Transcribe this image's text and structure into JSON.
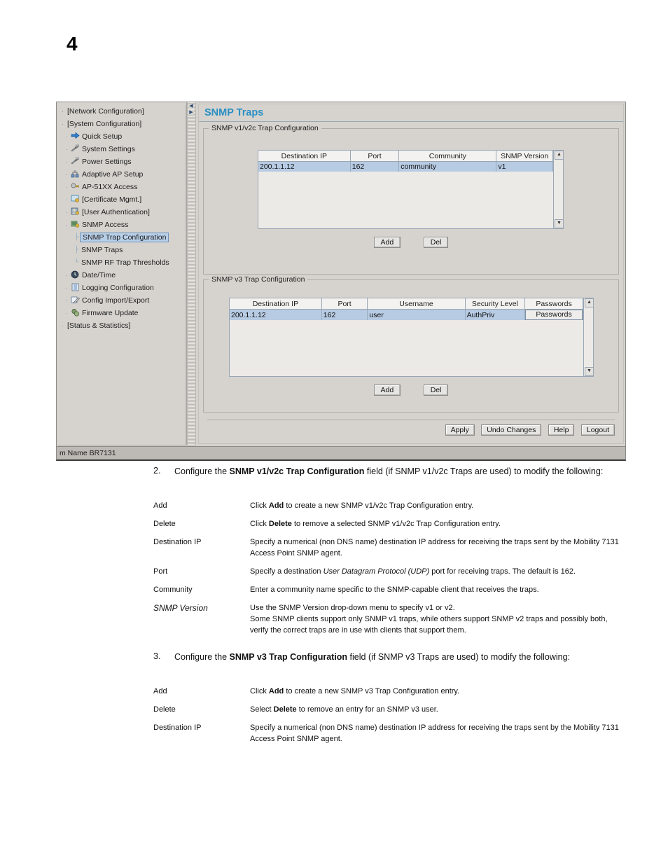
{
  "page": {
    "number": "4"
  },
  "screenshot": {
    "panel_title": "SNMP Traps",
    "sidebar": {
      "items": [
        {
          "label": "[Network Configuration]",
          "icon": "none",
          "level": 0,
          "selected": false
        },
        {
          "label": "[System Configuration]",
          "icon": "none",
          "level": 0,
          "selected": false
        },
        {
          "label": "Quick Setup",
          "icon": "arrow-right-icon",
          "level": 1,
          "selected": false
        },
        {
          "label": "System Settings",
          "icon": "wrench-icon",
          "level": 1,
          "selected": false
        },
        {
          "label": "Power Settings",
          "icon": "wrench-icon",
          "level": 1,
          "selected": false
        },
        {
          "label": "Adaptive AP Setup",
          "icon": "network-icon",
          "level": 1,
          "selected": false
        },
        {
          "label": "AP-51XX Access",
          "icon": "key-icon",
          "level": 1,
          "selected": false
        },
        {
          "label": "[Certificate Mgmt.]",
          "icon": "certificate-icon",
          "level": 1,
          "selected": false
        },
        {
          "label": "[User Authentication]",
          "icon": "user-key-icon",
          "level": 1,
          "selected": false
        },
        {
          "label": "SNMP Access",
          "icon": "snmp-key-icon",
          "level": 1,
          "selected": false
        },
        {
          "label": "SNMP Trap Configuration",
          "icon": "none",
          "level": 2,
          "selected": true
        },
        {
          "label": "SNMP Traps",
          "icon": "none",
          "level": 2,
          "selected": false
        },
        {
          "label": "SNMP RF Trap Thresholds",
          "icon": "none",
          "level": 2,
          "selected": false
        },
        {
          "label": "Date/Time",
          "icon": "clock-icon",
          "level": 1,
          "selected": false
        },
        {
          "label": "Logging Configuration",
          "icon": "list-icon",
          "level": 1,
          "selected": false
        },
        {
          "label": "Config Import/Export",
          "icon": "pencil-icon",
          "level": 1,
          "selected": false
        },
        {
          "label": "Firmware Update",
          "icon": "chips-icon",
          "level": 1,
          "selected": false
        },
        {
          "label": "[Status & Statistics]",
          "icon": "none",
          "level": 0,
          "selected": false
        }
      ]
    },
    "group_v1": {
      "legend": "SNMP v1/v2c Trap Configuration",
      "columns": [
        "Destination IP",
        "Port",
        "Community",
        "SNMP Version"
      ],
      "rows": [
        [
          "200.1.1.12",
          "162",
          "community",
          "v1"
        ]
      ],
      "add_label": "Add",
      "del_label": "Del"
    },
    "group_v3": {
      "legend": "SNMP v3 Trap Configuration",
      "columns": [
        "Destination IP",
        "Port",
        "Username",
        "Security Level",
        "Passwords"
      ],
      "rows": [
        [
          "200.1.1.12",
          "162",
          "user",
          "AuthPriv",
          "Passwords"
        ]
      ],
      "add_label": "Add",
      "del_label": "Del"
    },
    "footer_buttons": {
      "apply": "Apply",
      "undo": "Undo Changes",
      "help": "Help",
      "logout": "Logout"
    },
    "statusbar": "m Name BR7131"
  },
  "doc": {
    "step2": {
      "number": "2.",
      "lead_a": "Configure the ",
      "lead_bold": "SNMP v1/v2c Trap Configuration",
      "lead_b": " field (if SNMP v1/v2c Traps are used) to modify the following:",
      "rows": [
        {
          "term": "Add",
          "desc_a": "Click ",
          "desc_bold": "Add",
          "desc_b": " to create a new SNMP v1/v2c Trap Configuration entry."
        },
        {
          "term": "Delete",
          "desc_a": "Click ",
          "desc_bold": "Delete",
          "desc_b": " to remove a selected SNMP v1/v2c Trap Configuration entry."
        },
        {
          "term": "Destination IP",
          "desc_a": "Specify a numerical (non DNS name) destination IP address for receiving the traps sent by the Mobility 7131 Access Point SNMP agent.",
          "desc_bold": "",
          "desc_b": ""
        },
        {
          "term": "Port",
          "desc_a": "Specify a destination ",
          "desc_italic": "User Datagram Protocol (UDP)",
          "desc_b": " port for receiving traps. The default is 162."
        },
        {
          "term": "Community",
          "desc_a": "Enter a community name specific to the SNMP-capable client that receives the traps.",
          "desc_bold": "",
          "desc_b": ""
        },
        {
          "term": "SNMP Version",
          "term_italic": true,
          "desc_a": "Use the SNMP Version drop-down menu to specify v1 or v2.",
          "desc_line2": "Some SNMP clients support only SNMP v1 traps, while others support SNMP v2 traps and possibly both, verify the correct traps are in use with clients that support them."
        }
      ]
    },
    "step3": {
      "number": "3.",
      "lead_a": "Configure the ",
      "lead_bold": "SNMP v3 Trap Configuration",
      "lead_b": " field (if SNMP v3 Traps are used) to modify the following:",
      "rows": [
        {
          "term": "Add",
          "desc_a": "Click ",
          "desc_bold": "Add",
          "desc_b": " to create a new SNMP v3 Trap Configuration entry."
        },
        {
          "term": "Delete",
          "desc_a": "Select ",
          "desc_bold": "Delete",
          "desc_b": " to remove an entry for an SNMP v3 user."
        },
        {
          "term": "Destination IP",
          "desc_a": "Specify a numerical (non DNS name) destination IP address for receiving the traps sent by the Mobility 7131 Access Point SNMP agent.",
          "desc_bold": "",
          "desc_b": ""
        }
      ]
    }
  }
}
